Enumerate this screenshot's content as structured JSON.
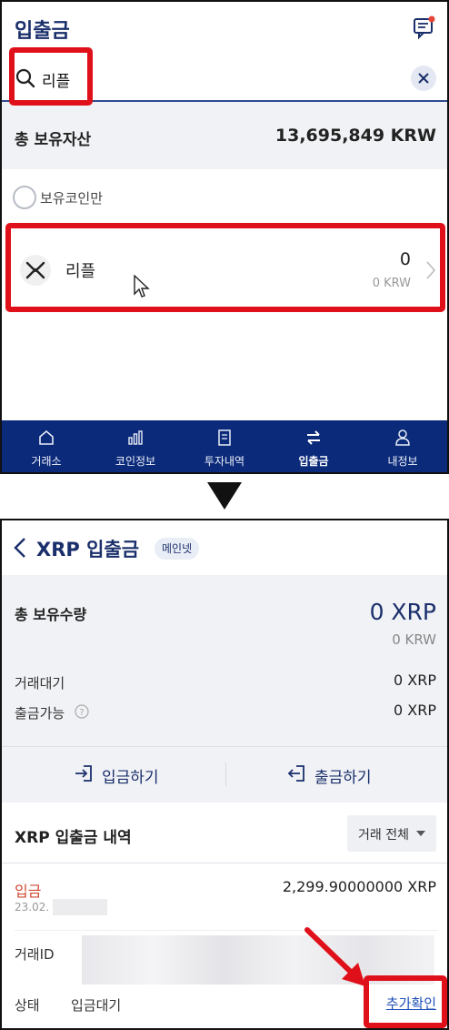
{
  "top": {
    "title": "입출금",
    "search": {
      "value": "리플"
    },
    "summary": {
      "label": "총 보유자산",
      "value": "13,695,849 KRW"
    },
    "filter": {
      "label": "보유코인만"
    },
    "coin": {
      "name": "리플",
      "quantity": "0",
      "krw": "0 KRW"
    },
    "nav": [
      {
        "label": "거래소",
        "icon": "exchange-home-icon"
      },
      {
        "label": "코인정보",
        "icon": "chart-icon"
      },
      {
        "label": "투자내역",
        "icon": "document-icon"
      },
      {
        "label": "입출금",
        "icon": "transfer-icon",
        "active": true
      },
      {
        "label": "내정보",
        "icon": "user-icon"
      }
    ]
  },
  "bottom": {
    "title": "XRP 입출금",
    "network_badge": "메인넷",
    "holdings": {
      "label": "총 보유수량",
      "value": "0 XRP",
      "krw": "0 KRW",
      "pending_label": "거래대기",
      "pending_value": "0 XRP",
      "available_label": "출금가능",
      "available_value": "0 XRP"
    },
    "actions": {
      "deposit": "입금하기",
      "withdraw": "출금하기"
    },
    "history": {
      "title": "XRP 입출금 내역",
      "filter": "거래 전체",
      "transaction": {
        "type": "입금",
        "amount": "2,299.90000000 XRP",
        "date": "23.02.",
        "txid_label": "거래ID",
        "status_label": "상태",
        "status_value": "입금대기",
        "more_label": "추가확인"
      }
    }
  },
  "colors": {
    "brand_navy": "#0b2a7a",
    "highlight_red": "#e0101a",
    "deposit_red": "#d24a33",
    "link_blue": "#1e4fb8"
  }
}
